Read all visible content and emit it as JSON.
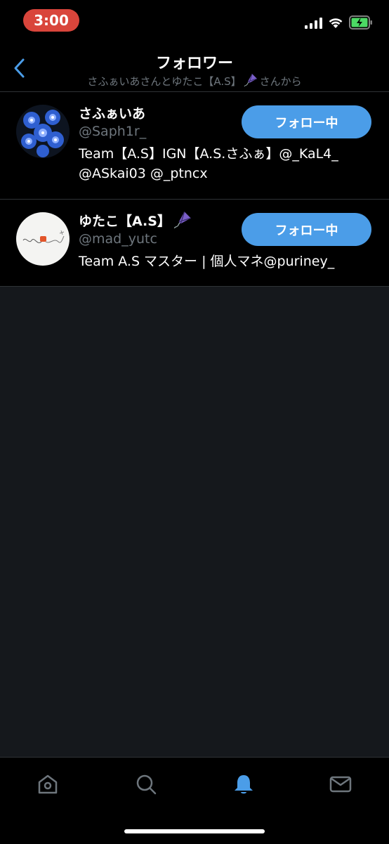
{
  "status": {
    "time": "3:00"
  },
  "header": {
    "title": "フォロワー",
    "subtitle_prefix": "さふぁいあさんとゆたこ【A.S】",
    "subtitle_suffix": "さんから"
  },
  "users": [
    {
      "name": "さふぁいあ",
      "handle": "@Saph1r_",
      "bio": "Team【A.S】IGN【A.S.さふぁ】@_KaL4_ @ASkai03 @_ptncx",
      "button": "フォロー中"
    },
    {
      "name": "ゆたこ【A.S】",
      "handle": "@mad_yutc",
      "bio": "Team A.S マスター | 個人マネ@puriney_",
      "button": "フォロー中"
    }
  ],
  "colors": {
    "accent": "#4b9de8",
    "background": "#15181c",
    "secondary_text": "#6e767d",
    "time_pill": "#d9453b"
  },
  "tabs": [
    {
      "icon": "home-icon",
      "active": false
    },
    {
      "icon": "search-icon",
      "active": false
    },
    {
      "icon": "bell-icon",
      "active": true
    },
    {
      "icon": "mail-icon",
      "active": false
    }
  ]
}
